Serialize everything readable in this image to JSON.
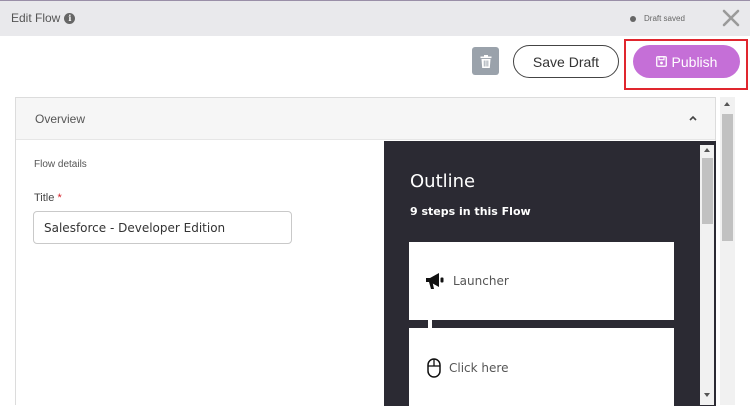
{
  "header": {
    "title": "Edit Flow",
    "info_icon": "info-icon",
    "draft_status": "Draft saved",
    "close_icon": "close-icon"
  },
  "toolbar": {
    "delete_icon": "trash-icon",
    "save_draft_label": "Save Draft",
    "publish_label": "Publish",
    "publish_icon": "save-icon",
    "publish_color": "#c56fd7",
    "highlight_color": "#e0262e"
  },
  "panel": {
    "header_label": "Overview",
    "flow_details_label": "Flow details",
    "title_label": "Title",
    "required_marker": "*",
    "title_value": "Salesforce - Developer Edition"
  },
  "outline": {
    "heading": "Outline",
    "steps_summary": "9 steps in this Flow",
    "background": "#2b2a33",
    "steps": [
      {
        "label": "Launcher",
        "icon": "megaphone-icon"
      },
      {
        "label": "Click here",
        "icon": "mouse-icon"
      }
    ]
  }
}
